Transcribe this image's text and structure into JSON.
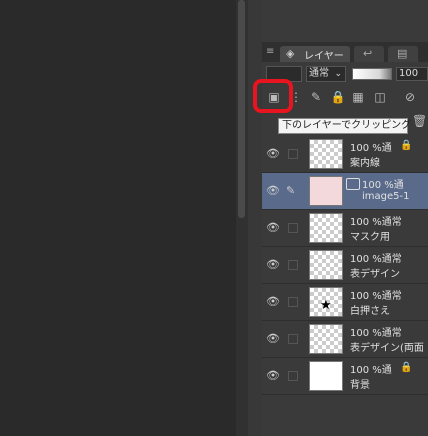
{
  "panel": {
    "tab_label": "レイヤー",
    "blend_mode": "通常",
    "opacity": "100",
    "tooltip": "下のレイヤーでクリッピング"
  },
  "layers": [
    {
      "line1": "100 %通",
      "line2": "案内線"
    },
    {
      "line1": "100 %通",
      "line2": "image5-1"
    },
    {
      "line1": "100 %通常",
      "line2": "マスク用"
    },
    {
      "line1": "100 %通常",
      "line2": "表デザイン"
    },
    {
      "line1": "100 %通常",
      "line2": "白押さえ"
    },
    {
      "line1": "100 %通常",
      "line2": "表デザイン(両面"
    },
    {
      "line1": "100 %通",
      "line2": "背景"
    }
  ],
  "colors": {
    "highlight": "#e8141f",
    "selected": "#5a6a8a"
  }
}
